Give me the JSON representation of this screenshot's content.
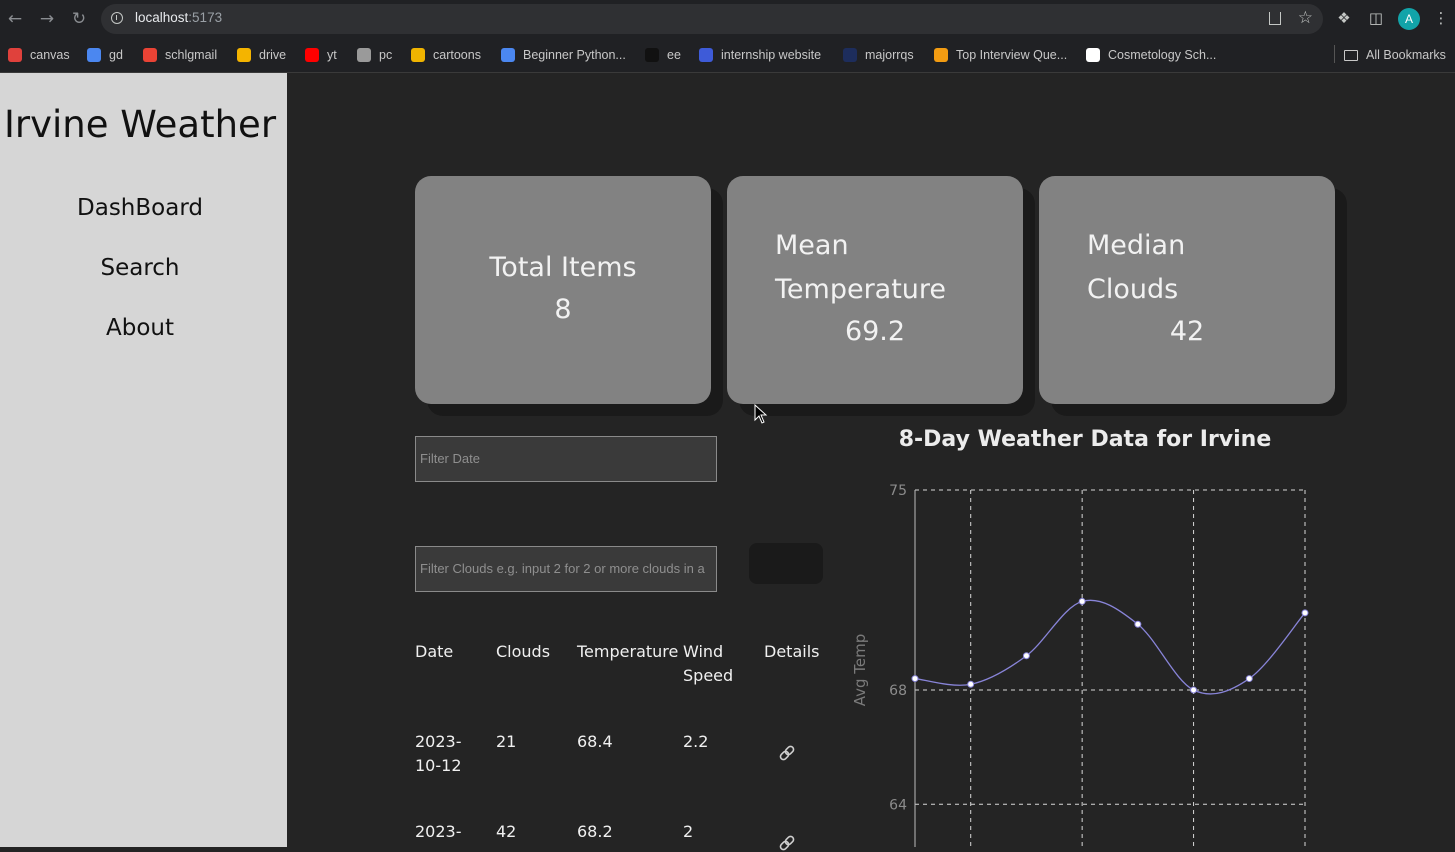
{
  "browser": {
    "url_host": "localhost",
    "url_port": ":5173",
    "profile_initial": "A",
    "bookmarks": [
      {
        "label": "canvas",
        "color": "#e0413c"
      },
      {
        "label": "gd",
        "color": "#4b87f0"
      },
      {
        "label": "schlgmail",
        "color": "#ea4335"
      },
      {
        "label": "drive",
        "color": "#f4b400"
      },
      {
        "label": "yt",
        "color": "#ff0000"
      },
      {
        "label": "pc",
        "color": "#9a9a9a"
      },
      {
        "label": "cartoons",
        "color": "#f0b400"
      },
      {
        "label": "Beginner Python...",
        "color": "#4b87f0"
      },
      {
        "label": "ee",
        "color": "#111111"
      },
      {
        "label": "internship website",
        "color": "#3e5bd8"
      },
      {
        "label": "majorrqs",
        "color": "#1d2d5c"
      },
      {
        "label": "Top Interview Que...",
        "color": "#f39c12"
      },
      {
        "label": "Cosmetology Sch...",
        "color": "#ffffff"
      }
    ],
    "all_bookmarks": "All Bookmarks"
  },
  "sidebar": {
    "title": "Irvine Weather",
    "items": [
      "DashBoard",
      "Search",
      "About"
    ]
  },
  "cards": [
    {
      "label_lines": [
        "Total Items"
      ],
      "value": "8"
    },
    {
      "label_lines": [
        "Mean",
        "Temperature"
      ],
      "value": "69.2"
    },
    {
      "label_lines": [
        "Median",
        "Clouds"
      ],
      "value": "42"
    }
  ],
  "filters": {
    "date_placeholder": "Filter Date",
    "clouds_placeholder": "Filter Clouds e.g. input 2 for 2 or more clouds in a"
  },
  "table": {
    "headers": [
      "Date",
      "Clouds",
      "Temperature",
      "Wind Speed",
      "Details"
    ],
    "rows": [
      {
        "date": "2023-10-12",
        "clouds": "21",
        "temperature": "68.4",
        "wind": "2.2"
      },
      {
        "date": "2023-",
        "clouds": "42",
        "temperature": "68.2",
        "wind": "2"
      }
    ]
  },
  "chart_data": {
    "type": "line",
    "title": "8-Day Weather Data for Irvine",
    "ylabel": "Avg Temp",
    "y_ticks": [
      75,
      68,
      64
    ],
    "ylim": [
      62,
      75
    ],
    "values": [
      68.4,
      68.2,
      69.2,
      71.1,
      70.3,
      68.0,
      68.4,
      70.7
    ],
    "line_color": "#8884d8",
    "grid": true
  }
}
